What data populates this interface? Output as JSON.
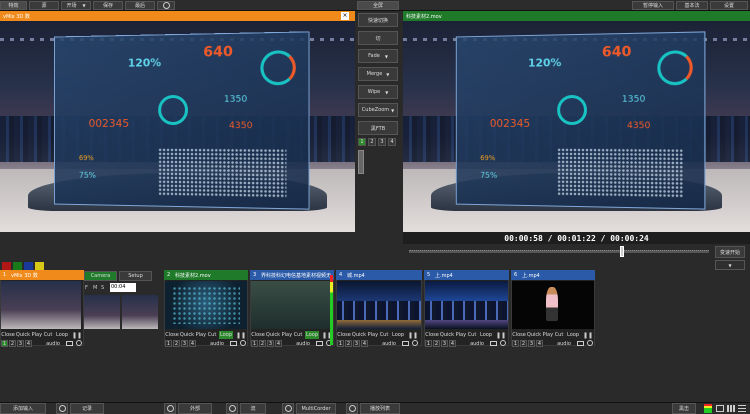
{
  "top_left_toolbar": {
    "active_tab": "特效",
    "buttons": [
      "源",
      "开场",
      "保存",
      "最后"
    ]
  },
  "top_right_toolbar": {
    "fullscreen": "全屏",
    "buttons": [
      "暂停输入",
      "基本法",
      "设置"
    ]
  },
  "preview": {
    "title": "vMix 3D 数"
  },
  "program": {
    "title": "科技素材2.mov",
    "timecode_elapsed": "00:00:58",
    "timecode_duration": "00:01:22",
    "timecode_remaining": "00:00:24",
    "seek_position": 0.71
  },
  "transitions": {
    "header": "快速切换",
    "cut": "切",
    "items": [
      "Fade",
      "Merge",
      "Wipe",
      "CubeZoom"
    ],
    "ftb": "黑FTB",
    "pages": [
      "1",
      "2",
      "3",
      "4"
    ],
    "active_page": "1"
  },
  "program_side_button": "变速开始",
  "infographic": {
    "pct1": "120%",
    "num1": "640",
    "num2": "1350",
    "num3": "002345",
    "num4": "4350",
    "pct2": "69%",
    "pct3": "75%"
  },
  "color_swatches": [
    "#b01818",
    "#1a7a1a",
    "#1a3a9a",
    "#d8c818"
  ],
  "inputs": [
    {
      "num": "1",
      "name": "vMix 3D 数",
      "header_color": "#f08a1a",
      "tabs": [
        "Camera",
        "Setup"
      ],
      "fields": [
        "F",
        "M",
        "S"
      ],
      "field_value": "00:04"
    },
    {
      "num": "2",
      "name": "科技素材2.mov",
      "header_color": "#1f7a2a"
    },
    {
      "num": "3",
      "name": "界科技科幻电信基地素材视频无",
      "header_color": "#2a5aa8"
    },
    {
      "num": "4",
      "name": "城.mp4",
      "header_color": "#2a5aa8"
    },
    {
      "num": "5",
      "name": "上.mp4",
      "header_color": "#2a5aa8"
    },
    {
      "num": "6",
      "name": "上.mp4",
      "header_color": "#2a5aa8"
    }
  ],
  "input_controls": {
    "close": "Close",
    "quick_play": "Quick Play",
    "cut": "Cut",
    "loop": "Loop",
    "numbers": [
      "1",
      "2",
      "3",
      "4"
    ],
    "audio": "audio"
  },
  "bottom_bar": {
    "add_input": "添加输入",
    "record": "记录",
    "external": "外部",
    "stream": "流",
    "multicorder": "MultiCorder",
    "playlist": "播放列表",
    "right_label": "黑击"
  }
}
